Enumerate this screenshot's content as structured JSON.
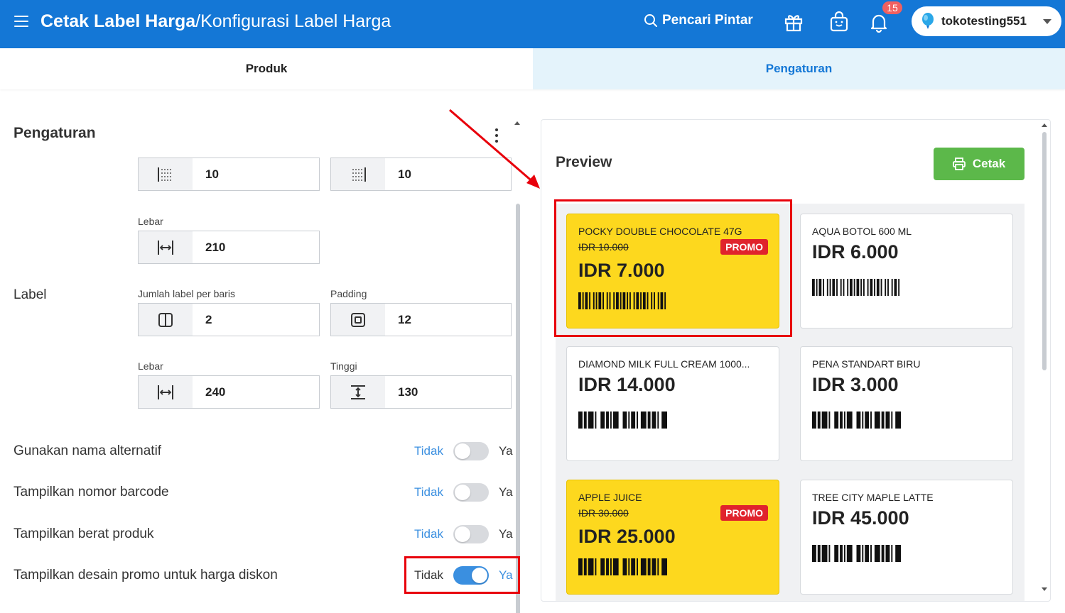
{
  "header": {
    "title_main": "Cetak Label Harga",
    "title_sep": "/",
    "title_sub": "Konfigurasi Label Harga",
    "smart_search": "Pencari Pintar",
    "notification_count": "15",
    "store_name": "tokotesting551",
    "bar_color": "#1477d6"
  },
  "tabs": [
    {
      "label": "Produk",
      "active": false
    },
    {
      "label": "Pengaturan",
      "active": true
    }
  ],
  "settings": {
    "heading": "Pengaturan",
    "page_fields": {
      "margin_left": "10",
      "margin_right": "10",
      "width_label": "Lebar",
      "width": "210"
    },
    "label_section": {
      "section_label": "Label",
      "per_row_label": "Jumlah label per baris",
      "per_row": "2",
      "padding_label": "Padding",
      "padding": "12",
      "width_label": "Lebar",
      "width": "240",
      "height_label": "Tinggi",
      "height": "130"
    },
    "toggles": [
      {
        "label": "Gunakan nama alternatif",
        "off_text": "Tidak",
        "on_text": "Ya",
        "on": false
      },
      {
        "label": "Tampilkan nomor barcode",
        "off_text": "Tidak",
        "on_text": "Ya",
        "on": false
      },
      {
        "label": "Tampilkan berat produk",
        "off_text": "Tidak",
        "on_text": "Ya",
        "on": false
      },
      {
        "label": "Tampilkan desain promo untuk harga diskon",
        "off_text": "Tidak",
        "on_text": "Ya",
        "on": true
      }
    ]
  },
  "preview": {
    "title": "Preview",
    "print_button": "Cetak",
    "promo_color": "#fdd81e",
    "badge_color": "#e0232c",
    "labels": [
      {
        "name": "POCKY DOUBLE CHOCOLATE 47G",
        "old_price": "IDR 10.000",
        "badge": "PROMO",
        "price": "IDR 7.000",
        "promo": true
      },
      {
        "name": "AQUA BOTOL 600 ML",
        "price": "IDR 6.000",
        "promo": false
      },
      {
        "name": "DIAMOND MILK FULL CREAM 1000...",
        "price": "IDR 14.000",
        "promo": false
      },
      {
        "name": "PENA STANDART BIRU",
        "price": "IDR 3.000",
        "promo": false
      },
      {
        "name": "APPLE JUICE",
        "old_price": "IDR 30.000",
        "badge": "PROMO",
        "price": "IDR 25.000",
        "promo": true
      },
      {
        "name": "TREE CITY MAPLE LATTE",
        "price": "IDR 45.000",
        "promo": false
      }
    ]
  }
}
